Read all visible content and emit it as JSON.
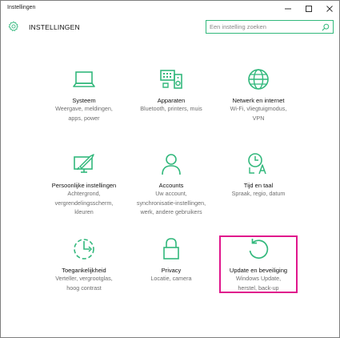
{
  "window": {
    "title": "Instellingen"
  },
  "header": {
    "title": "INSTELLINGEN"
  },
  "search": {
    "placeholder": "Een instelling zoeken"
  },
  "colors": {
    "accent": "#32b87c",
    "highlight": "#e0168c"
  },
  "tiles": [
    {
      "icon": "laptop-icon",
      "title": "Systeem",
      "desc": [
        "Weergave, meldingen,",
        "apps, power"
      ]
    },
    {
      "icon": "devices-icon",
      "title": "Apparaten",
      "desc": [
        "Bluetooth, printers, muis"
      ]
    },
    {
      "icon": "globe-icon",
      "title": "Netwerk en internet",
      "desc": [
        "Wi-Fi, vliegtuigmodus,",
        "VPN"
      ]
    },
    {
      "icon": "personalization-icon",
      "title": "Persoonlijke instellingen",
      "desc": [
        "Achtergrond,",
        "vergrendelingsscherm,",
        "kleuren"
      ]
    },
    {
      "icon": "person-icon",
      "title": "Accounts",
      "desc": [
        "Uw account,",
        "synchronisatie-instellingen,",
        "werk, andere gebruikers"
      ]
    },
    {
      "icon": "time-language-icon",
      "title": "Tijd en taal",
      "desc": [
        "Spraak, regio, datum"
      ]
    },
    {
      "icon": "ease-of-access-icon",
      "title": "Toegankelijkheid",
      "desc": [
        "Verteller, vergrootglas,",
        "hoog contrast"
      ]
    },
    {
      "icon": "lock-icon",
      "title": "Privacy",
      "desc": [
        "Locatie, camera"
      ]
    },
    {
      "icon": "update-icon",
      "title": "Update en beveiliging",
      "desc": [
        "Windows Update,",
        "herstel, back-up"
      ]
    }
  ]
}
